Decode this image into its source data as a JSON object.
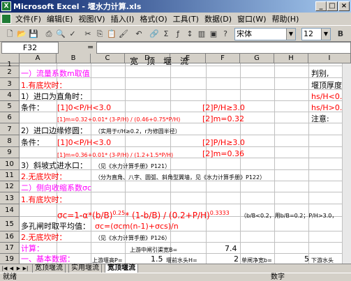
{
  "window": {
    "title": "Microsoft Excel - 堰水力计算.xls",
    "app_icon": "excel-icon"
  },
  "menu": [
    "文件(F)",
    "编辑(E)",
    "视图(V)",
    "插入(I)",
    "格式(O)",
    "工具(T)",
    "数据(D)",
    "窗口(W)",
    "帮助(H)"
  ],
  "toolbar": {
    "font_name": "宋体",
    "font_size": "12",
    "icons": [
      "new-icon",
      "open-icon",
      "save-icon",
      "print-icon",
      "preview-icon",
      "spell-icon",
      "cut-icon",
      "copy-icon",
      "paste-icon",
      "format-painter-icon",
      "undo-icon",
      "hyperlink-icon",
      "sum-icon",
      "fx-icon",
      "sort-asc-icon",
      "chart-icon",
      "zoom-icon",
      "help-icon"
    ]
  },
  "formula_bar": {
    "name_box": "F32",
    "eq": "=",
    "value": ""
  },
  "columns": [
    "A",
    "B",
    "C",
    "D",
    "E",
    "F",
    "G",
    "H",
    "I"
  ],
  "rows": [
    "1",
    "2",
    "3",
    "4",
    "5",
    "6",
    "7",
    "8",
    "9",
    "10",
    "11",
    "12",
    "13",
    "14",
    "15",
    "16",
    "17",
    "18",
    "19",
    "20"
  ],
  "cells": {
    "r2_title": "宽　顶　堰　流",
    "r3_a": "一）流量系数m取值",
    "r3_i": "判别,",
    "r4_a": "1.有底坎时：",
    "r4_i": "堰顶厚度",
    "r5_a": "1）进口为直角时：",
    "r5_i": "hs/H<0.",
    "r6_a": "条件：",
    "r6_b": "[1]0<P/H<3.0",
    "r6_f": "[2]P/H≥3.0",
    "r6_i": "hs/H>0.",
    "r7_b": "[1]m=0.32+0.01* (3-P/H) / (0.46+0.75*P/H)",
    "r7_f": "[2]m=0.32",
    "r7_i": "注意:",
    "r8_a": "2）进口边缘修圆：",
    "r8_c": "（实用于r/H≥0.2，r为修圆半径）",
    "r9_a": "条件：",
    "r9_b": "[1]0<P/H<3.0",
    "r9_f": "[2]P/H≥3.0",
    "r10_b": "[1]m=0.36+0.01* (3-P/H) / (1.2+1.5*P/H)",
    "r10_f": "[2]m=0.36",
    "r11_a": "3）斜坡式进水口：",
    "r11_c": "（见《水力计算手册》P121）",
    "r12_a": "2.无底坎时：",
    "r12_c": "（分为直角、八字、圆弧、斜角型翼墙，见《水力计算手册》P122）",
    "r13_a": "二）侧向收缩系数σc",
    "r14_a": "1.有底坎时：",
    "r15_formula": "σc=1-α*(b/B)",
    "r15_exp1": "0.25",
    "r15_formula2": "* (1-b/B) / (0.2+P/H)",
    "r15_exp2": "0.3333",
    "r15_h": "（b/B<0.2，用b/B=0.2；P/H>3.0，",
    "r16_a": "多孔闸时取平均值：",
    "r16_c": "σc=(σcm(n-1)+σcs)/n",
    "r17_a": "2.无底坎时：",
    "r17_c": "（见《水力计算手册》P126）",
    "r19_a": "计算：",
    "r19_d": "上游中闸引渠宽B=",
    "r19_f": "7.4",
    "r20_a": "一、基本数据：",
    "r20_c": "上游堰高P=",
    "r20_d": "1.5",
    "r20_e": "堰前水头H=",
    "r20_f": "2",
    "r20_g": "单闸净宽b=",
    "r20_h": "5",
    "r20_i": "下游水头"
  },
  "sheets": [
    "宽顶堰流",
    "实用堰流",
    "宽顶堰流"
  ],
  "status": "就绪",
  "status_right": "数字"
}
